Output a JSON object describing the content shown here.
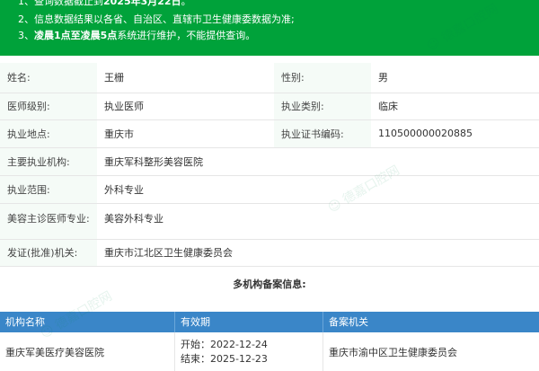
{
  "notice": {
    "line1_prefix": "1、查询数据截止到",
    "line1_date": "2025年3月22日",
    "line1_suffix": "。",
    "line2": "2、信息数据结果以各省、自治区、直辖市卫生健康委数据为准;",
    "line3_prefix": "3、",
    "line3_bold": "凌晨1点至凌晨5点",
    "line3_suffix": "系统进行维护，不能提供查询。"
  },
  "doctor": {
    "name_label": "姓名:",
    "name": "王栅",
    "gender_label": "性别:",
    "gender": "男",
    "level_label": "医师级别:",
    "level": "执业医师",
    "category_label": "执业类别:",
    "category": "临床",
    "location_label": "执业地点:",
    "location": "重庆市",
    "cert_label": "执业证书编码:",
    "cert_no": "110500000020885",
    "institution_label": "主要执业机构:",
    "institution": "重庆军科整形美容医院",
    "scope_label": "执业范围:",
    "scope": "外科专业",
    "cosmetic_label": "美容主诊医师专业:",
    "cosmetic": "美容外科专业",
    "issuer_label": "发证(批准)机关:",
    "issuer": "重庆市江北区卫生健康委员会"
  },
  "multi": {
    "title": "多机构备案信息:",
    "headers": [
      "机构名称",
      "有效期",
      "备案机关"
    ],
    "rows": [
      {
        "org": "重庆军美医疗美容医院",
        "start": "开始：2022-12-24",
        "end": "结束：2025-12-23",
        "authority": "重庆市渝中区卫生健康委员会"
      }
    ]
  },
  "watermark": "德嘉口腔网"
}
